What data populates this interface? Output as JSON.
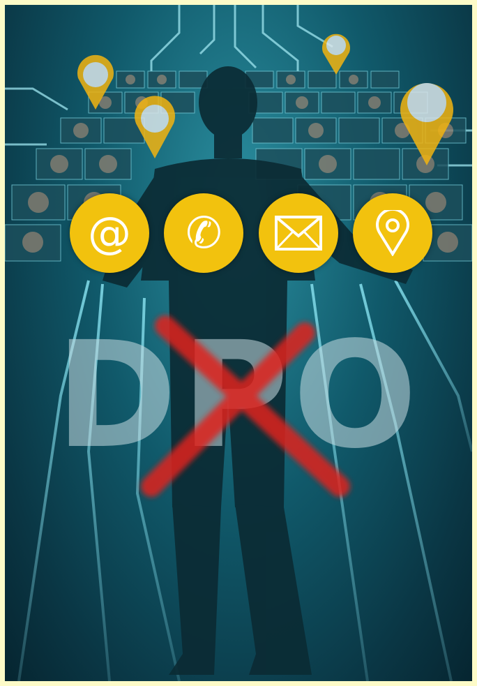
{
  "image": {
    "overlay_text": "DPO",
    "overlay_struck_through": true,
    "contact_icons": [
      {
        "name": "email-at-icon",
        "glyph": "@"
      },
      {
        "name": "phone-icon",
        "glyph": "✆"
      },
      {
        "name": "envelope-icon",
        "glyph": "✉"
      },
      {
        "name": "location-pin-icon",
        "glyph": ""
      }
    ],
    "colors": {
      "border": "#fdfbc8",
      "background": "#10596a",
      "accent_yellow": "#f2c20e",
      "cross_red": "#e0201c"
    }
  }
}
